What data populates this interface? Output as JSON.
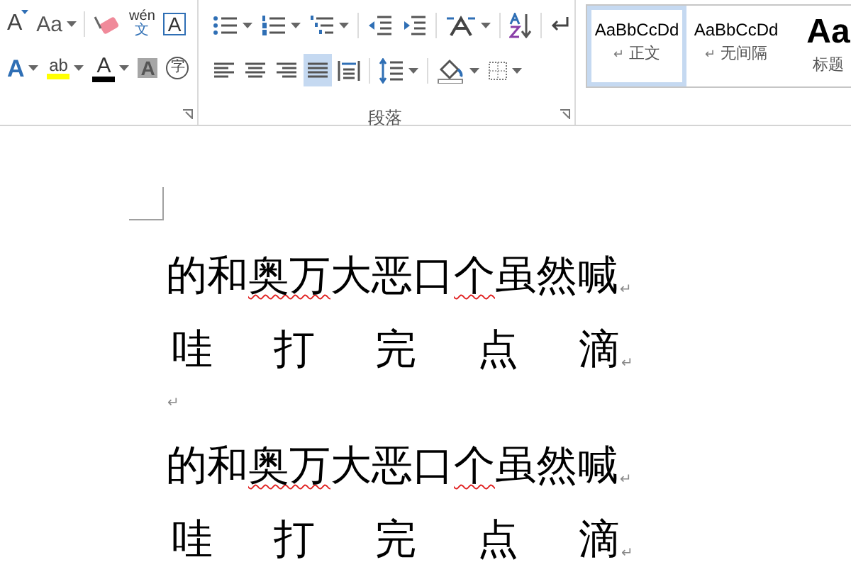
{
  "ribbon": {
    "font_group": {
      "rows": [
        [
          {
            "kind": "shrink-font",
            "text": "A",
            "dropdown": false
          },
          {
            "kind": "change-case",
            "text": "Aa",
            "dropdown": true
          },
          {
            "kind": "clear-format",
            "dropdown": false
          },
          {
            "kind": "phonetic",
            "text": "wén",
            "sub": "文",
            "dropdown": false
          },
          {
            "kind": "char-border",
            "text": "A",
            "dropdown": false
          }
        ],
        [
          {
            "kind": "text-effect",
            "text": "A",
            "dropdown": true
          },
          {
            "kind": "highlight",
            "text": "ab",
            "color": "#ffff00",
            "dropdown": true
          },
          {
            "kind": "font-color",
            "text": "A",
            "color": "#000000",
            "dropdown": true
          },
          {
            "kind": "char-shading",
            "text": "A",
            "dropdown": false
          },
          {
            "kind": "enclose",
            "text": "字",
            "dropdown": false
          }
        ]
      ]
    },
    "paragraph_group": {
      "label": "段落",
      "rows": [
        [
          {
            "kind": "bullets",
            "dropdown": true,
            "selected": false
          },
          {
            "kind": "numbering",
            "dropdown": true,
            "selected": false
          },
          {
            "kind": "multilevel",
            "dropdown": true,
            "selected": false
          },
          {
            "kind": "sep"
          },
          {
            "kind": "outdent",
            "dropdown": false,
            "selected": false
          },
          {
            "kind": "indent",
            "dropdown": false,
            "selected": false
          },
          {
            "kind": "sep"
          },
          {
            "kind": "direction",
            "dropdown": true,
            "selected": false
          },
          {
            "kind": "sep"
          },
          {
            "kind": "sort",
            "dropdown": false,
            "selected": false
          },
          {
            "kind": "sep"
          },
          {
            "kind": "marks",
            "dropdown": false,
            "selected": false
          }
        ],
        [
          {
            "kind": "align-left",
            "dropdown": false,
            "selected": false
          },
          {
            "kind": "align-center",
            "dropdown": false,
            "selected": false
          },
          {
            "kind": "align-right",
            "dropdown": false,
            "selected": false
          },
          {
            "kind": "justify",
            "dropdown": false,
            "selected": true
          },
          {
            "kind": "distribute",
            "dropdown": false,
            "selected": false
          },
          {
            "kind": "sep"
          },
          {
            "kind": "line-spacing",
            "dropdown": true,
            "selected": false
          },
          {
            "kind": "sep"
          },
          {
            "kind": "shading",
            "dropdown": true,
            "selected": false
          },
          {
            "kind": "borders",
            "dropdown": true,
            "selected": false
          }
        ]
      ]
    },
    "styles": [
      {
        "sample": "AaBbCcDd",
        "label": "正文",
        "mark": "↵",
        "selected": true,
        "kind": "normal"
      },
      {
        "sample": "AaBbCcDd",
        "label": "无间隔",
        "mark": "↵",
        "selected": false,
        "kind": "normal"
      },
      {
        "sample": "Aa",
        "label": "标题",
        "selected": false,
        "kind": "heading"
      }
    ]
  },
  "document": {
    "paragraphs": [
      {
        "kind": "text",
        "segments": [
          {
            "text": "的和",
            "misspelled": false
          },
          {
            "text": "奥万",
            "misspelled": true
          },
          {
            "text": "大恶口",
            "misspelled": false
          },
          {
            "text": "个",
            "misspelled": true
          },
          {
            "text": "虽然喊",
            "misspelled": false
          }
        ],
        "mark": "↵"
      },
      {
        "kind": "distributed",
        "characters": [
          "哇",
          "打",
          "完",
          "点",
          "滴"
        ],
        "mark": "↵"
      },
      {
        "kind": "empty",
        "mark": "↵"
      },
      {
        "kind": "text",
        "segments": [
          {
            "text": "的和",
            "misspelled": false
          },
          {
            "text": "奥万",
            "misspelled": true
          },
          {
            "text": "大恶口",
            "misspelled": false
          },
          {
            "text": "个",
            "misspelled": true
          },
          {
            "text": "虽然喊",
            "misspelled": false
          }
        ],
        "mark": "↵"
      },
      {
        "kind": "distributed",
        "characters": [
          "哇",
          "打",
          "完",
          "点",
          "滴"
        ],
        "mark": "↵"
      }
    ]
  }
}
